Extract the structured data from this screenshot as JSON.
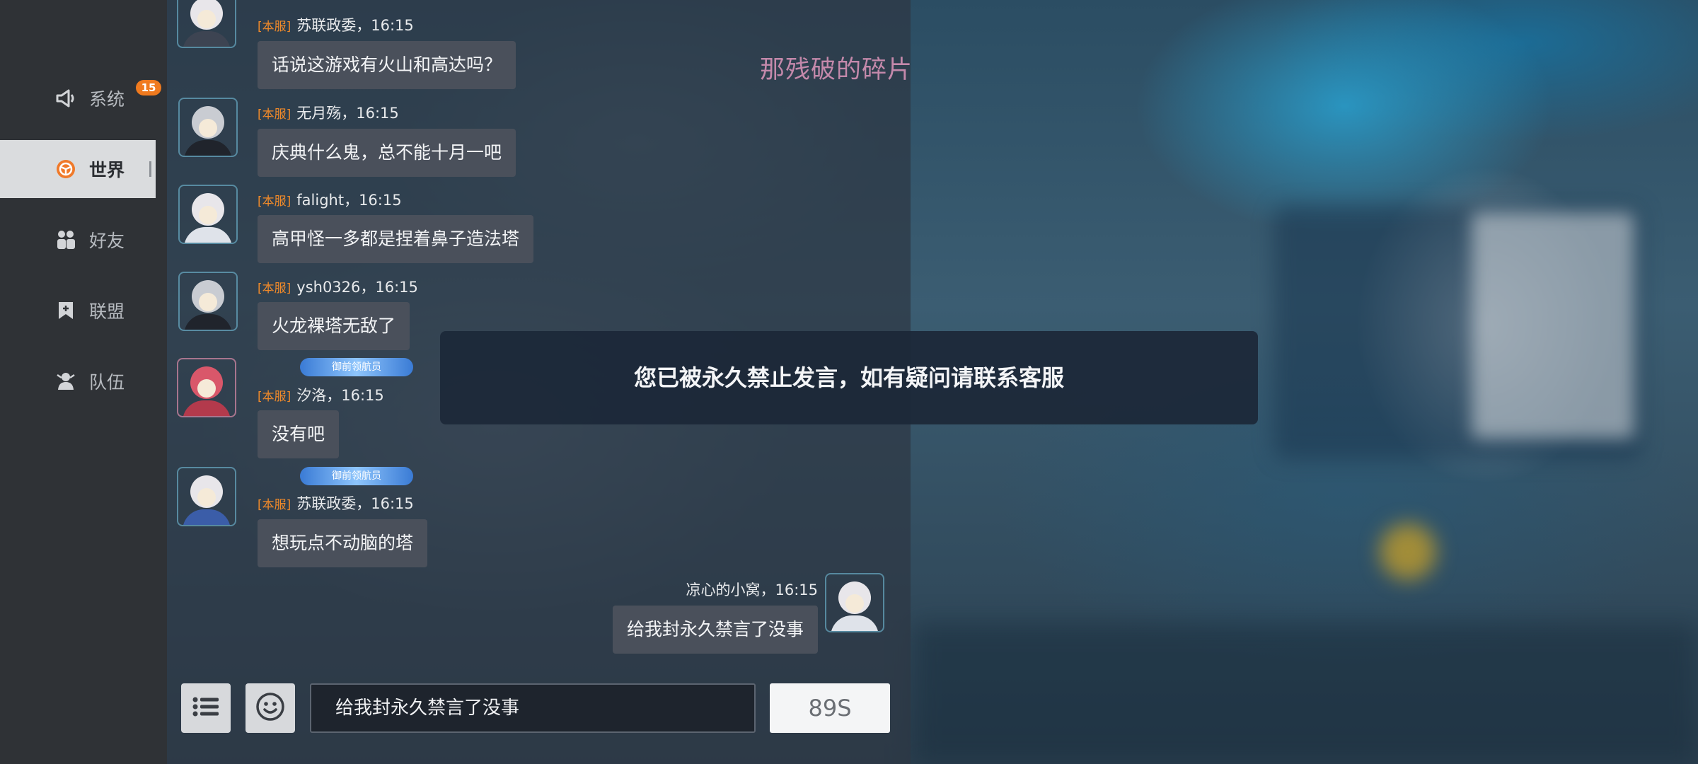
{
  "nav": {
    "items": [
      {
        "label": "系统",
        "icon": "megaphone-icon",
        "badge": "15"
      },
      {
        "label": "世界",
        "icon": "steering-wheel-icon",
        "active": true
      },
      {
        "label": "好友",
        "icon": "friends-icon"
      },
      {
        "label": "联盟",
        "icon": "alliance-bookmark-icon"
      },
      {
        "label": "队伍",
        "icon": "team-icon"
      }
    ]
  },
  "watermark": "那残破的碎片",
  "messages": [
    {
      "server": "[本服]",
      "sender_time": "苏联政委，16:15",
      "text": "话说这游戏有火山和高达吗？",
      "partial_top": true
    },
    {
      "server": "[本服]",
      "sender_time": "无月殇，16:15",
      "text": "庆典什么鬼，总不能十月一吧"
    },
    {
      "server": "[本服]",
      "sender_time": "falight，16:15",
      "text": "高甲怪一多都是捏着鼻子造法塔"
    },
    {
      "server": "[本服]",
      "sender_time": "ysh0326，16:15",
      "text": "火龙裸塔无敌了"
    },
    {
      "server": "[本服]",
      "sender_time": "汐洛，16:15",
      "text": "没有吧",
      "title_tag": "御前领航员"
    },
    {
      "server": "[本服]",
      "sender_time": "苏联政委，16:15",
      "text": "想玩点不动脑的塔",
      "title_tag": "御前领航员"
    },
    {
      "sender_time": "凉心的小窝，16:15",
      "text": "给我封永久禁言了没事",
      "self": true
    }
  ],
  "input": {
    "value": "给我封永久禁言了没事"
  },
  "send_cooldown": "89S",
  "toast": "您已被永久禁止发言，如有疑问请联系客服",
  "colors": {
    "accent": "#f07a2a",
    "server_tag": "#f08a2a",
    "watermark": "#c489ab"
  }
}
